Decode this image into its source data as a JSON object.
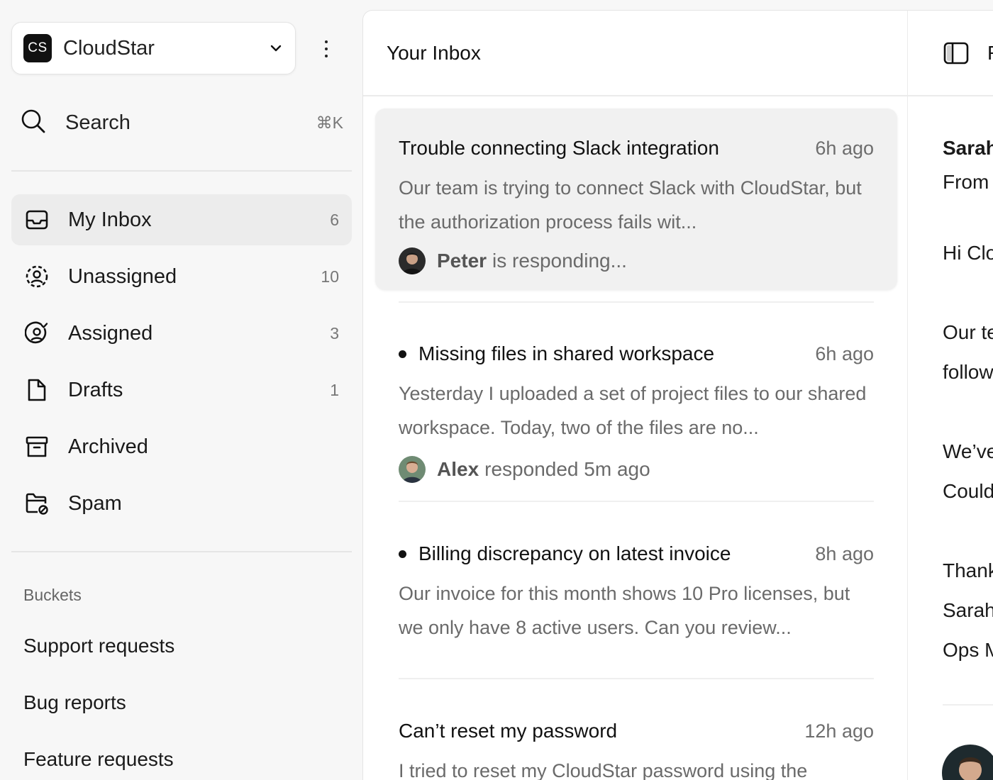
{
  "workspace": {
    "logo_text": "CS",
    "name": "CloudStar"
  },
  "search": {
    "label": "Search",
    "shortcut": "⌘K"
  },
  "nav": {
    "items": [
      {
        "label": "My Inbox",
        "count": "6",
        "icon": "inbox-tray-icon",
        "active": true
      },
      {
        "label": "Unassigned",
        "count": "10",
        "icon": "user-dashed-circle-icon"
      },
      {
        "label": "Assigned",
        "count": "3",
        "icon": "user-check-circle-icon"
      },
      {
        "label": "Drafts",
        "count": "1",
        "icon": "file-icon"
      },
      {
        "label": "Archived",
        "count": "",
        "icon": "archive-box-icon"
      },
      {
        "label": "Spam",
        "count": "",
        "icon": "folder-blocked-icon"
      }
    ]
  },
  "buckets": {
    "title": "Buckets",
    "items": [
      "Support requests",
      "Bug reports",
      "Feature requests"
    ]
  },
  "inbox": {
    "title": "Your Inbox",
    "conversations": [
      {
        "subject": "Trouble connecting Slack integration",
        "time": "6h ago",
        "unread": false,
        "selected": true,
        "preview": "Our team is trying to connect Slack with CloudStar, but the authorization process fails wit...",
        "actor": "Peter",
        "activity": "is responding..."
      },
      {
        "subject": "Missing files in shared workspace",
        "time": "6h ago",
        "unread": true,
        "preview": "Yesterday I uploaded a set of project files to our shared workspace. Today, two of the files are no...",
        "actor": "Alex",
        "activity": "responded 5m ago"
      },
      {
        "subject": "Billing discrepancy on latest invoice",
        "time": "8h ago",
        "unread": true,
        "preview": "Our invoice for this month shows 10 Pro licenses, but we only have 8 active users. Can you review..."
      },
      {
        "subject": "Can’t reset my password",
        "time": "12h ago",
        "unread": false,
        "preview": "I tried to reset my CloudStar password using the"
      }
    ]
  },
  "detail": {
    "title": "R",
    "lines": [
      "Sarah",
      "From",
      "Hi Clo",
      "Our te",
      "follow",
      "We’ve",
      "Could",
      "Thank",
      "Sarah",
      "Ops M"
    ]
  },
  "colors": {
    "accent": "#111111",
    "selected_bg": "#f1f1f1",
    "muted_text": "#6a6a6a"
  }
}
